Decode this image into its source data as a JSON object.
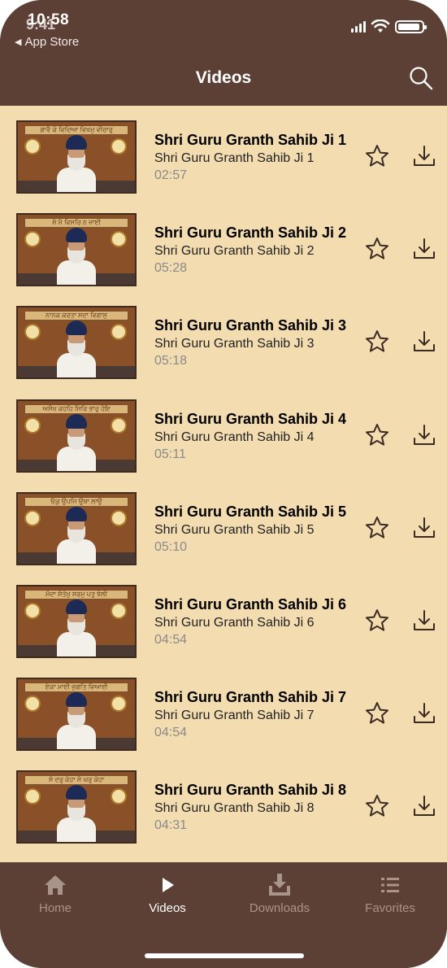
{
  "status_bar": {
    "time": "10:58",
    "time_overlay": "9:41",
    "back_label": "App Store"
  },
  "header": {
    "title": "Videos",
    "search_icon": "search-icon"
  },
  "videos": [
    {
      "title": "Shri Guru Granth Sahib Ji 1",
      "subtitle": "Shri Guru Granth Sahib Ji 1",
      "duration": "02:57",
      "banner": "ਗਾਵੈ ਕੋ ਵਿਦਿਆ ਵਿਖਮੁ ਵੀਚਾਰੁ"
    },
    {
      "title": "Shri Guru Granth Sahib Ji 2",
      "subtitle": "Shri Guru Granth Sahib Ji 2",
      "duration": "05:28",
      "banner": "ਸੋ ਮੈ ਵਿਸਰਿ ਨ ਜਾਈ"
    },
    {
      "title": "Shri Guru Granth Sahib Ji 3",
      "subtitle": "Shri Guru Granth Sahib Ji 3",
      "duration": "05:18",
      "banner": "ਨਾਨਕ ਕਰਤਾ ਸਦਾ ਵਿਗਾਸੁ"
    },
    {
      "title": "Shri Guru Granth Sahib Ji 4",
      "subtitle": "Shri Guru Granth Sahib Ji 4",
      "duration": "05:11",
      "banner": "ਅਸੰਖ ਕਹਹਿ ਸਿਰਿ ਭਾਰੁ ਹੋਇ"
    },
    {
      "title": "Shri Guru Granth Sahib Ji 5",
      "subtitle": "Shri Guru Granth Sahib Ji 5",
      "duration": "05:10",
      "banner": "ਓਕੁ ਉਪਜਿ ਉਥਾ ਲਾਉ"
    },
    {
      "title": "Shri Guru Granth Sahib Ji 6",
      "subtitle": "Shri Guru Granth Sahib Ji 6",
      "duration": "04:54",
      "banner": "ਮੰਦਾ ਸੰਤੋਖੁ ਸਰਮੁ ਪਤੁ ਝੋਲੀ"
    },
    {
      "title": "Shri Guru Granth Sahib Ji 7",
      "subtitle": "Shri Guru Granth Sahib Ji 7",
      "duration": "04:54",
      "banner": "ਏਕਾ ਮਾਈ ਜੁਗਤਿ ਵਿਆਈ"
    },
    {
      "title": "Shri Guru Granth Sahib Ji 8",
      "subtitle": "Shri Guru Granth Sahib Ji 8",
      "duration": "04:31",
      "banner": "ਸੋ ਦਰੁ ਕੇਹਾ ਸੋ ਘਰੁ ਕੇਹਾ"
    }
  ],
  "tabs": [
    {
      "label": "Home",
      "icon": "home-icon",
      "active": false
    },
    {
      "label": "Videos",
      "icon": "play-icon",
      "active": true
    },
    {
      "label": "Downloads",
      "icon": "download-tray-icon",
      "active": false
    },
    {
      "label": "Favorites",
      "icon": "list-icon",
      "active": false
    }
  ],
  "colors": {
    "header_bg": "#5c4036",
    "list_bg": "#f3dcb0",
    "tab_active": "#ffffff",
    "tab_inactive": "#a9948a"
  }
}
